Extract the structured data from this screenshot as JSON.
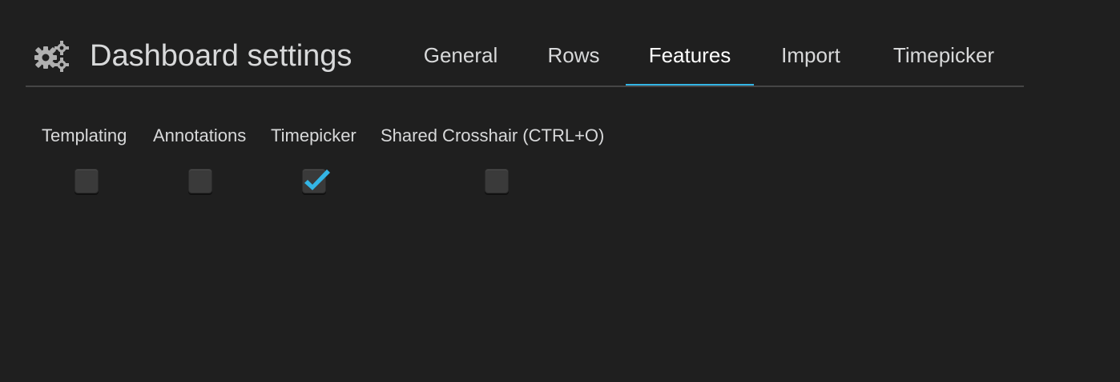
{
  "header": {
    "icon": "cogs-icon",
    "title": "Dashboard settings"
  },
  "tabs": [
    {
      "label": "General",
      "active": false
    },
    {
      "label": "Rows",
      "active": false
    },
    {
      "label": "Features",
      "active": true
    },
    {
      "label": "Import",
      "active": false
    },
    {
      "label": "Timepicker",
      "active": false
    }
  ],
  "features": [
    {
      "label": "Templating",
      "checked": false
    },
    {
      "label": "Annotations",
      "checked": false
    },
    {
      "label": "Timepicker",
      "checked": true
    },
    {
      "label": "Shared Crosshair (CTRL+O)",
      "checked": false
    }
  ],
  "colors": {
    "background": "#1f1f1f",
    "text": "#d8d9da",
    "accent": "#33b5e5",
    "divider": "#454545",
    "checkbox": "#3a3a3a"
  }
}
